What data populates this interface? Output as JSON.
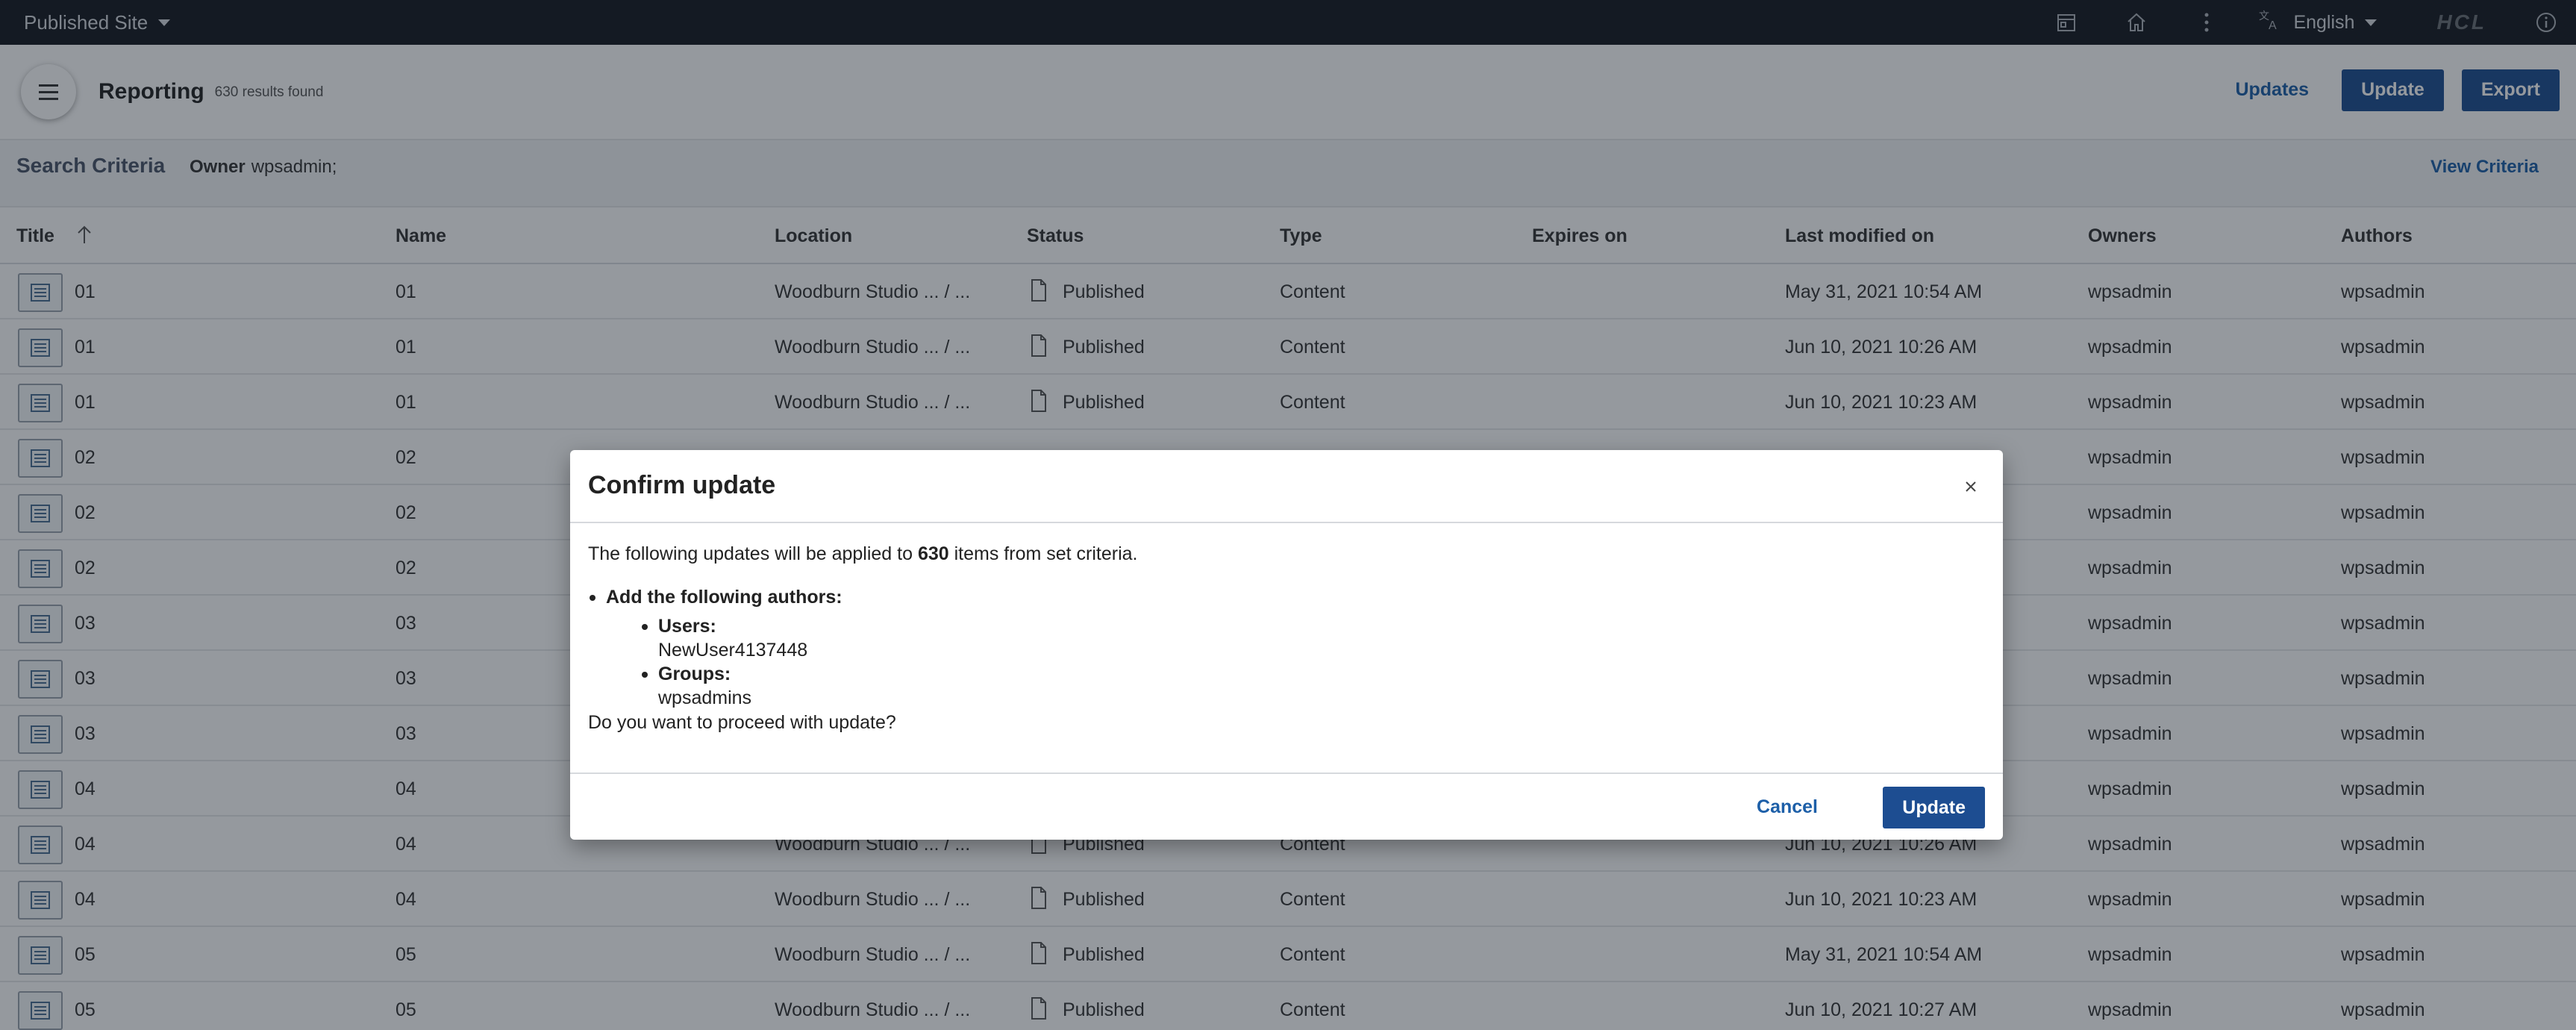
{
  "topbar": {
    "site_label": "Published Site",
    "language": "English",
    "logo_text": "HCL"
  },
  "header": {
    "title": "Reporting",
    "result_count": "630 results found",
    "updates_label": "Updates",
    "update_label": "Update",
    "export_label": "Export"
  },
  "criteria": {
    "label": "Search Criteria",
    "owner_key": "Owner",
    "owner_value": "wpsadmin;",
    "view_label": "View Criteria"
  },
  "table": {
    "headers": {
      "title": "Title",
      "name": "Name",
      "location": "Location",
      "status": "Status",
      "type": "Type",
      "expires": "Expires on",
      "modified": "Last modified on",
      "owners": "Owners",
      "authors": "Authors"
    },
    "rows": [
      {
        "title": "01",
        "name": "01",
        "location": "Woodburn Studio ... / ...",
        "status": "Published",
        "type": "Content",
        "expires": "",
        "modified": "May 31, 2021 10:54 AM",
        "owners": "wpsadmin",
        "authors": "wpsadmin"
      },
      {
        "title": "01",
        "name": "01",
        "location": "Woodburn Studio ... / ...",
        "status": "Published",
        "type": "Content",
        "expires": "",
        "modified": "Jun 10, 2021 10:26 AM",
        "owners": "wpsadmin",
        "authors": "wpsadmin"
      },
      {
        "title": "01",
        "name": "01",
        "location": "Woodburn Studio ... / ...",
        "status": "Published",
        "type": "Content",
        "expires": "",
        "modified": "Jun 10, 2021 10:23 AM",
        "owners": "wpsadmin",
        "authors": "wpsadmin"
      },
      {
        "title": "02",
        "name": "02",
        "location": "",
        "status": "",
        "type": "",
        "expires": "",
        "modified": "",
        "owners": "wpsadmin",
        "authors": "wpsadmin"
      },
      {
        "title": "02",
        "name": "02",
        "location": "",
        "status": "",
        "type": "",
        "expires": "",
        "modified": "",
        "owners": "wpsadmin",
        "authors": "wpsadmin"
      },
      {
        "title": "02",
        "name": "02",
        "location": "",
        "status": "",
        "type": "",
        "expires": "",
        "modified": "",
        "owners": "wpsadmin",
        "authors": "wpsadmin"
      },
      {
        "title": "03",
        "name": "03",
        "location": "",
        "status": "",
        "type": "",
        "expires": "",
        "modified": "",
        "owners": "wpsadmin",
        "authors": "wpsadmin"
      },
      {
        "title": "03",
        "name": "03",
        "location": "",
        "status": "",
        "type": "",
        "expires": "",
        "modified": "",
        "owners": "wpsadmin",
        "authors": "wpsadmin"
      },
      {
        "title": "03",
        "name": "03",
        "location": "",
        "status": "",
        "type": "",
        "expires": "",
        "modified": "",
        "owners": "wpsadmin",
        "authors": "wpsadmin"
      },
      {
        "title": "04",
        "name": "04",
        "location": "",
        "status": "",
        "type": "",
        "expires": "",
        "modified": "",
        "owners": "wpsadmin",
        "authors": "wpsadmin"
      },
      {
        "title": "04",
        "name": "04",
        "location": "Woodburn Studio ... / ...",
        "status": "Published",
        "type": "Content",
        "expires": "",
        "modified": "Jun 10, 2021 10:26 AM",
        "owners": "wpsadmin",
        "authors": "wpsadmin"
      },
      {
        "title": "04",
        "name": "04",
        "location": "Woodburn Studio ... / ...",
        "status": "Published",
        "type": "Content",
        "expires": "",
        "modified": "Jun 10, 2021 10:23 AM",
        "owners": "wpsadmin",
        "authors": "wpsadmin"
      },
      {
        "title": "05",
        "name": "05",
        "location": "Woodburn Studio ... / ...",
        "status": "Published",
        "type": "Content",
        "expires": "",
        "modified": "May 31, 2021 10:54 AM",
        "owners": "wpsadmin",
        "authors": "wpsadmin"
      },
      {
        "title": "05",
        "name": "05",
        "location": "Woodburn Studio ... / ...",
        "status": "Published",
        "type": "Content",
        "expires": "",
        "modified": "Jun 10, 2021 10:27 AM",
        "owners": "wpsadmin",
        "authors": "wpsadmin"
      }
    ]
  },
  "modal": {
    "title": "Confirm update",
    "intro_pre": "The following updates will be applied to ",
    "intro_count": "630",
    "intro_post": " items from set criteria.",
    "action_label": "Add the following authors:",
    "users_label": "Users:",
    "users_value": "NewUser4137448",
    "groups_label": "Groups:",
    "groups_value": "wpsadmins",
    "question": "Do you want to proceed with update?",
    "cancel_label": "Cancel",
    "update_label": "Update"
  },
  "colors": {
    "primary": "#1d4d91",
    "link": "#1d5fa8",
    "topbar": "#15181f",
    "overlay": "rgba(20,28,40,0.45)"
  },
  "icons": {
    "site_caret": "chevron-down-icon",
    "calendar": "calendar-icon",
    "home": "home-icon",
    "more": "more-vertical-icon",
    "translate": "translate-icon",
    "info": "info-icon",
    "menu": "hamburger-menu-icon",
    "sort": "sort-ascending-icon",
    "row": "content-item-icon",
    "status": "document-icon",
    "close": "close-icon"
  }
}
